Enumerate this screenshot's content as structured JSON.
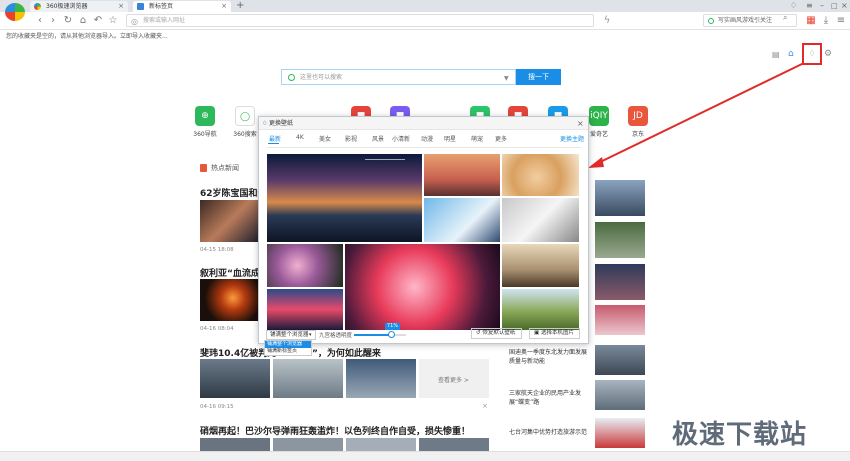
{
  "tabs": [
    {
      "label": "360极速浏览器"
    },
    {
      "label": "新标签页"
    }
  ],
  "address": {
    "placeholder": "搜索或输入网址"
  },
  "right_search": {
    "text": "写实画风游戏引关注"
  },
  "favbar": {
    "text": "您的收藏夹是空的，请从其他浏览器导入。立即导入收藏夹..."
  },
  "search": {
    "placeholder": "这里也可以搜索",
    "button": "搜一下"
  },
  "shortcuts": [
    {
      "label": "360导航",
      "color": "#2eb85c",
      "glyph": "⊕"
    },
    {
      "label": "360搜索",
      "color": "#ffffff",
      "glyph": "◯"
    },
    {
      "label": "",
      "color": "#e5443b",
      "glyph": "■"
    },
    {
      "label": "",
      "color": "#7a5cf0",
      "glyph": "■"
    },
    {
      "label": "",
      "color": "#2ec26a",
      "glyph": "■"
    },
    {
      "label": "",
      "color": "#e5443b",
      "glyph": "■"
    },
    {
      "label": "",
      "color": "#1a9be8",
      "glyph": "■"
    },
    {
      "label": "爱奇艺",
      "color": "#2cb34a",
      "glyph": "iQIY"
    },
    {
      "label": "京东",
      "color": "#e9563b",
      "glyph": "JD"
    }
  ],
  "news": {
    "section_title": "热点新闻",
    "items": [
      {
        "title": "62岁陈宝国和妻子",
        "time": "04-15 18:08"
      },
      {
        "title": "叙利亚“血流成河",
        "time": "04-16 08:04"
      },
      {
        "title": "斐玮10.4亿被判死",
        "time": "04-16 09:15",
        "tail": "”，为何如此醒来"
      },
      {
        "title": "硝烟再起！巴沙尔导弹雨狂轰滥炸！以色列终自作自受，损失惨重！",
        "time": ""
      }
    ],
    "more": "查看更多 >"
  },
  "side_news": [
    {
      "text": "国迪奥一季度东北发力面发展质量与新动能"
    },
    {
      "text": "三家航天企业的民用产业发展“蝶变”路"
    },
    {
      "text": "七台河集中优势打造旅游示范"
    }
  ],
  "modal": {
    "title": "更换壁纸",
    "categories": [
      "最新",
      "4K",
      "美女",
      "影视",
      "风景",
      "小清新",
      "动漫",
      "明星",
      "萌宠",
      "更多"
    ],
    "active_category": "最新",
    "theme_link": "更换主题",
    "fill_select": "铺满整个浏览器",
    "dropdown_options": [
      "铺满整个浏览器",
      "铺满新标签页"
    ],
    "transparency_label": "九宫格透明度",
    "slider_value": "71%",
    "slider_level": 0.71,
    "restore_button": "恢复默认壁纸",
    "local_button": "选择本机图片"
  },
  "colors": {
    "accent": "#1a8ee6",
    "highlight": "#e12b2b"
  },
  "watermark": "极速下载站"
}
